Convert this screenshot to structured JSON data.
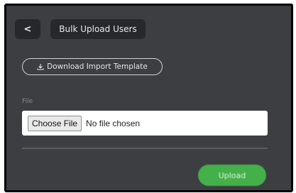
{
  "header": {
    "back_label": "<",
    "title": "Bulk Upload Users"
  },
  "download": {
    "icon": "download-icon",
    "label": "Download Import Template"
  },
  "file": {
    "label": "File",
    "choose_label": "Choose File",
    "status": "No file chosen"
  },
  "actions": {
    "upload_label": "Upload"
  },
  "colors": {
    "background": "#3c3e41",
    "header_button": "#26282b",
    "upload_button": "#44b04a"
  }
}
